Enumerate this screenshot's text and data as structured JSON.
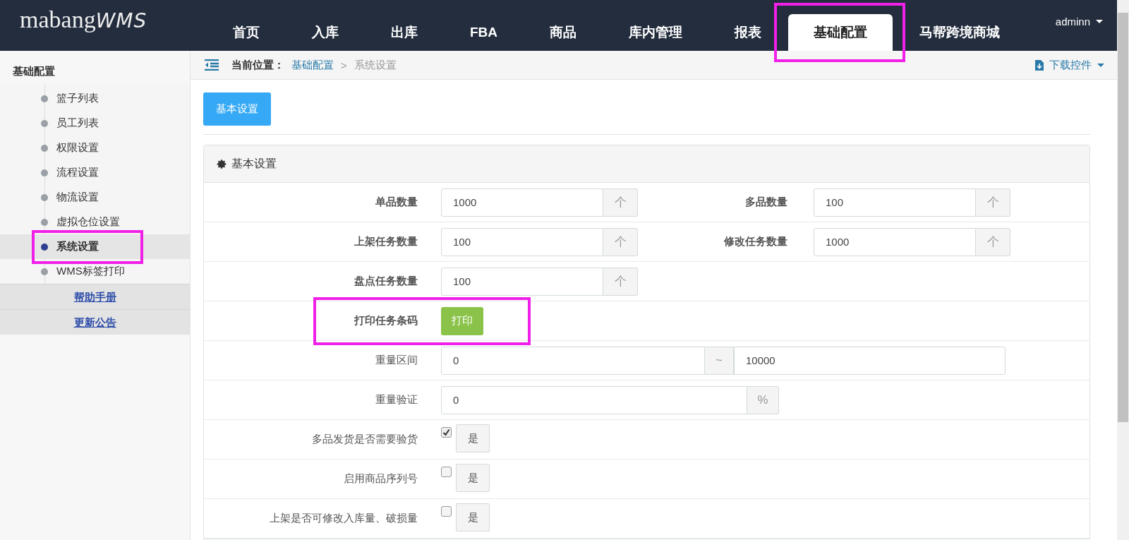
{
  "header": {
    "logo_main": "mabang",
    "logo_accent": "WMS",
    "user": "adminn",
    "nav": [
      {
        "label": "首页",
        "selected": false,
        "highlighted": false
      },
      {
        "label": "入库",
        "selected": false,
        "highlighted": false
      },
      {
        "label": "出库",
        "selected": false,
        "highlighted": false
      },
      {
        "label": "FBA",
        "selected": false,
        "highlighted": false
      },
      {
        "label": "商品",
        "selected": false,
        "highlighted": false
      },
      {
        "label": "库内管理",
        "selected": false,
        "highlighted": false
      },
      {
        "label": "报表",
        "selected": false,
        "highlighted": false
      },
      {
        "label": "基础配置",
        "selected": true,
        "highlighted": true
      },
      {
        "label": "马帮跨境商城",
        "selected": false,
        "highlighted": false
      }
    ]
  },
  "sidebar": {
    "title": "基础配置",
    "items": [
      {
        "label": "篮子列表",
        "selected": false,
        "highlighted": false
      },
      {
        "label": "员工列表",
        "selected": false,
        "highlighted": false
      },
      {
        "label": "权限设置",
        "selected": false,
        "highlighted": false
      },
      {
        "label": "流程设置",
        "selected": false,
        "highlighted": false
      },
      {
        "label": "物流设置",
        "selected": false,
        "highlighted": false
      },
      {
        "label": "虚拟仓位设置",
        "selected": false,
        "highlighted": false
      },
      {
        "label": "系统设置",
        "selected": true,
        "highlighted": true
      },
      {
        "label": "WMS标签打印",
        "selected": false,
        "highlighted": false
      }
    ],
    "links": [
      "帮助手册",
      "更新公告"
    ]
  },
  "breadcrumb": {
    "prefix": "当前位置：",
    "path": "基础配置",
    "separator": ">",
    "current": "系统设置",
    "download": "下载控件"
  },
  "tab_button": "基本设置",
  "panel": {
    "title": "基本设置",
    "rows": [
      {
        "kind": "fields",
        "highlighted": false,
        "fields": [
          {
            "label": "单品数量",
            "value": "1000",
            "unit": "个"
          },
          {
            "label": "多品数量",
            "value": "100",
            "unit": "个"
          }
        ]
      },
      {
        "kind": "fields",
        "highlighted": false,
        "fields": [
          {
            "label": "上架任务数量",
            "value": "100",
            "unit": "个"
          },
          {
            "label": "修改任务数量",
            "value": "1000",
            "unit": "个"
          }
        ]
      },
      {
        "kind": "fields",
        "highlighted": false,
        "fields": [
          {
            "label": "盘点任务数量",
            "value": "100",
            "unit": "个"
          }
        ]
      },
      {
        "kind": "button",
        "highlighted": true,
        "label": "打印任务条码",
        "button": "打印"
      },
      {
        "kind": "range",
        "highlighted": false,
        "label": "重量区间",
        "from": "0",
        "separator": "~",
        "to": "10000"
      },
      {
        "kind": "percent",
        "highlighted": false,
        "label": "重量验证",
        "value": "0",
        "unit": "%"
      },
      {
        "kind": "checkbox",
        "highlighted": false,
        "label": "多品发货是否需要验货",
        "checked": true,
        "option": "是"
      },
      {
        "kind": "checkbox",
        "highlighted": false,
        "label": "启用商品序列号",
        "checked": false,
        "option": "是"
      },
      {
        "kind": "checkbox",
        "highlighted": false,
        "label": "上架是否可修改入库量、破损量",
        "checked": false,
        "option": "是"
      }
    ]
  }
}
